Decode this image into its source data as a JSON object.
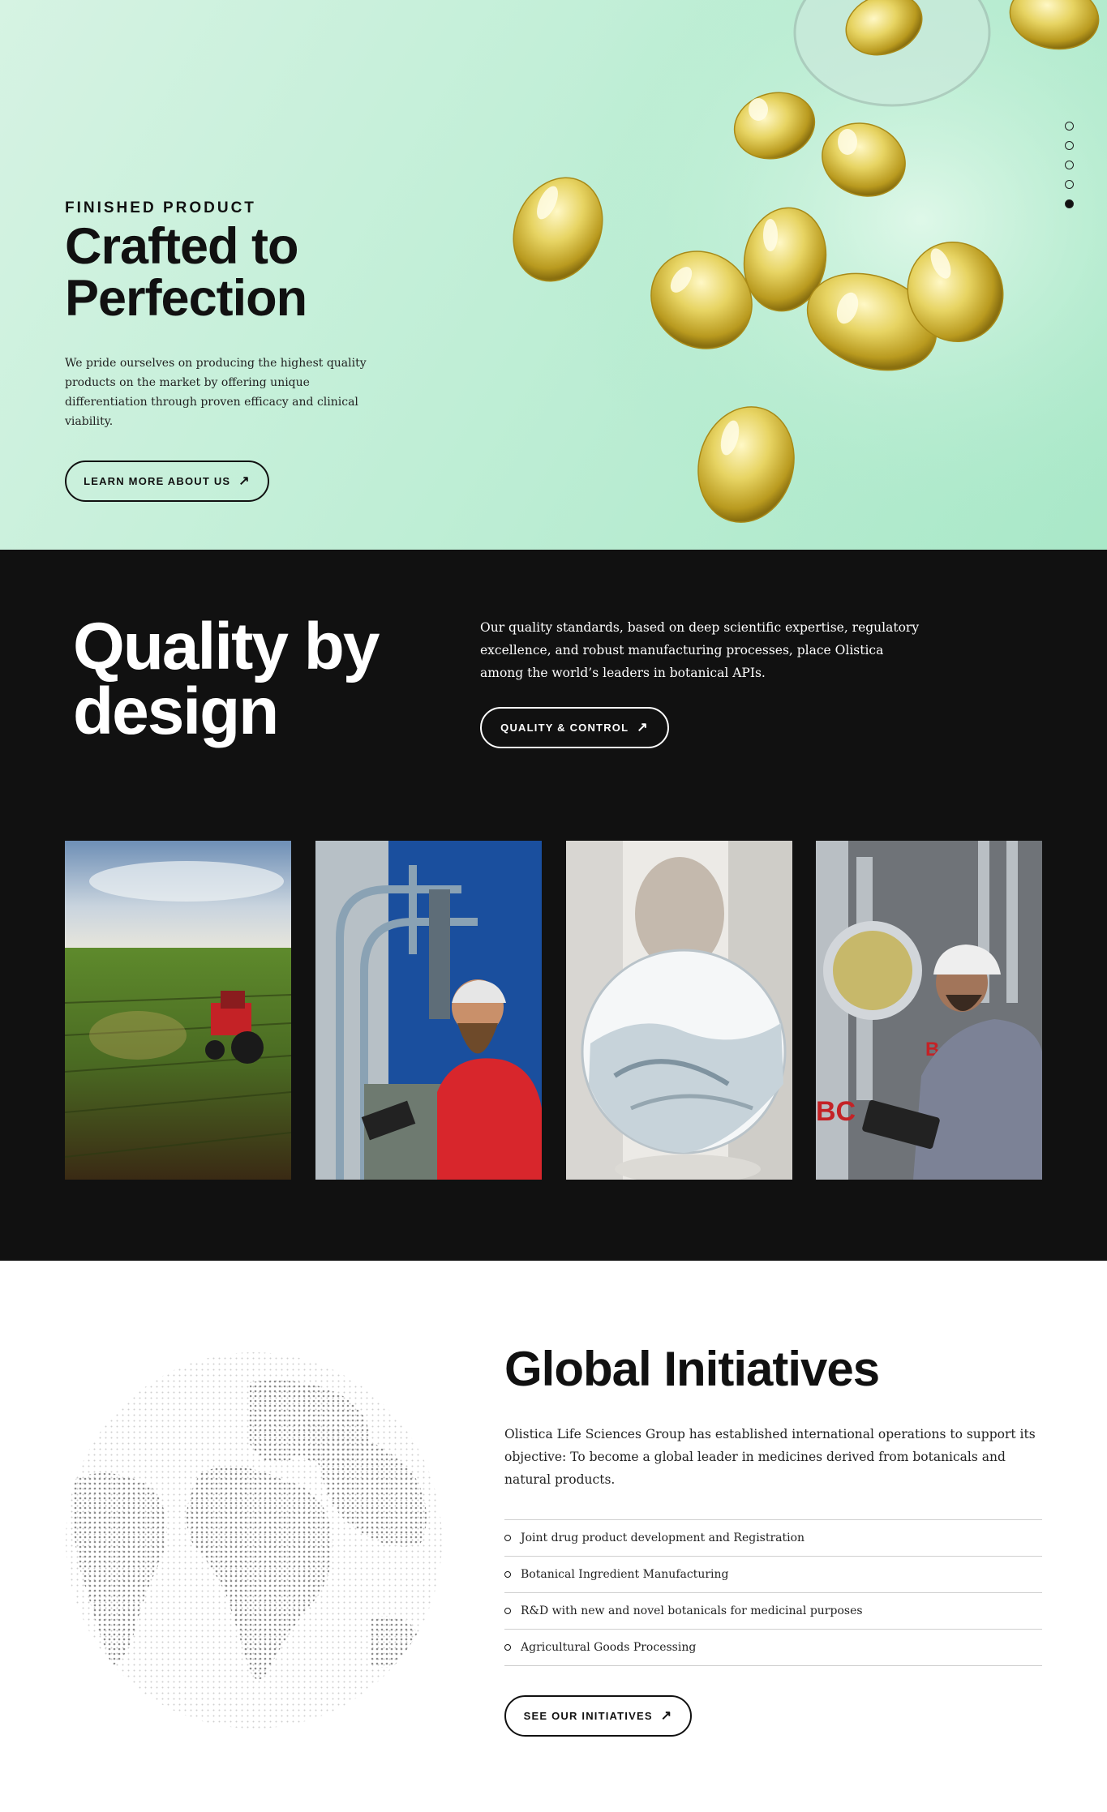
{
  "hero": {
    "eyebrow": "FINISHED PRODUCT",
    "title": "Crafted to Perfection",
    "body": "We pride ourselves on producing the highest quality products on the market by offering unique differentiation through proven efficacy and clinical viability.",
    "button_label": "LEARN MORE ABOUT US",
    "slide_count": 5,
    "active_slide": 5
  },
  "quality": {
    "title": "Quality by design",
    "body": "Our quality standards, based on deep scientific expertise, regulatory excellence, and robust manufacturing processes, place Olistica among the world’s leaders in botanical APIs.",
    "button_label": "QUALITY & CONTROL",
    "photos": [
      "tractor-field-photo",
      "worker-red-shirt-photo",
      "lab-flask-photo",
      "engineer-tablet-photo"
    ]
  },
  "global": {
    "title": "Global Initiatives",
    "body": "Olistica Life Sciences Group has established international operations to support its objective: To become a global leader in medicines derived from botanicals and natural products.",
    "items": [
      "Joint drug product development and Registration",
      "Botanical Ingredient Manufacturing",
      "R&D with new and novel botanicals for medicinal purposes",
      "Agricultural Goods Processing"
    ],
    "button_label": "SEE OUR INITIATIVES"
  },
  "colors": {
    "hero_bg": "#c3efd8",
    "dark_section": "#111111",
    "capsule": "#d9c24a",
    "accent_red": "#d8262c"
  },
  "icons": {
    "arrow": "arrow-up-right-icon",
    "bullet": "circle-bullet-icon",
    "slide": "slide-dot-icon"
  }
}
